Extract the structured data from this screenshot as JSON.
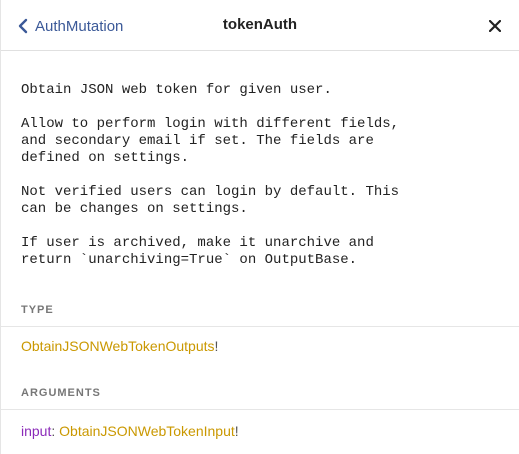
{
  "header": {
    "back_label": "AuthMutation",
    "title": "tokenAuth"
  },
  "description": [
    "Obtain JSON web token for given user.",
    "Allow to perform login with different fields,\nand secondary email if set. The fields are\ndefined on settings.",
    "Not verified users can login by default. This\ncan be changes on settings.",
    "If user is archived, make it unarchive and\nreturn `unarchiving=True` on OutputBase."
  ],
  "type_section": {
    "title": "TYPE",
    "type_name": "ObtainJSONWebTokenOutputs",
    "modifier": "!"
  },
  "arguments_section": {
    "title": "ARGUMENTS",
    "args": [
      {
        "name": "input",
        "colon": ": ",
        "type": "ObtainJSONWebTokenInput",
        "modifier": "!"
      }
    ]
  },
  "colors": {
    "link": "#3b5998",
    "type": "#ca9800",
    "arg_name": "#8b2bb9",
    "section_title": "#777777"
  },
  "icons": {
    "back": "chevron-left-icon",
    "close": "close-icon"
  }
}
